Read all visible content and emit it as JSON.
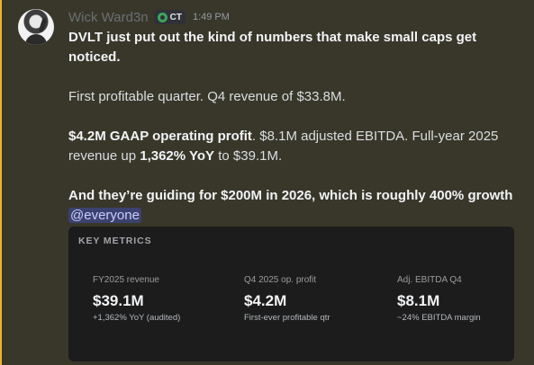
{
  "message": {
    "username": "Wick Ward3n",
    "tag": "CT",
    "timestamp": "1:49 PM",
    "line1": "DVLT just put out the kind of numbers that make small caps get noticed.",
    "line2": "First profitable quarter. Q4 revenue of $33.8M.",
    "line3_bold": "$4.2M GAAP operating profit",
    "line3_rest_a": ". $8.1M adjusted EBITDA. Full-year 2025 revenue up ",
    "line3_bold2": "1,362% YoY",
    "line3_rest_b": " to $39.1M.",
    "line4": "And they’re guiding for $200M in 2026, which is roughly 400% growth",
    "mention": "@everyone"
  },
  "embed": {
    "title": "KEY METRICS",
    "metrics": [
      {
        "label": "FY2025 revenue",
        "value": "$39.1M",
        "sub": "+1,362% YoY (audited)"
      },
      {
        "label": "Q4 2025 op. profit",
        "value": "$4.2M",
        "sub": "First-ever profitable qtr"
      },
      {
        "label": "Adj. EBITDA Q4",
        "value": "$8.1M",
        "sub": "~24% EBITDA margin"
      }
    ]
  },
  "colors": {
    "accent_bar": "#f0b232",
    "mention_bg": "#3c4270",
    "tag_icon": "#3ba55c"
  },
  "icons": {
    "tag": "guild-tag-icon"
  }
}
